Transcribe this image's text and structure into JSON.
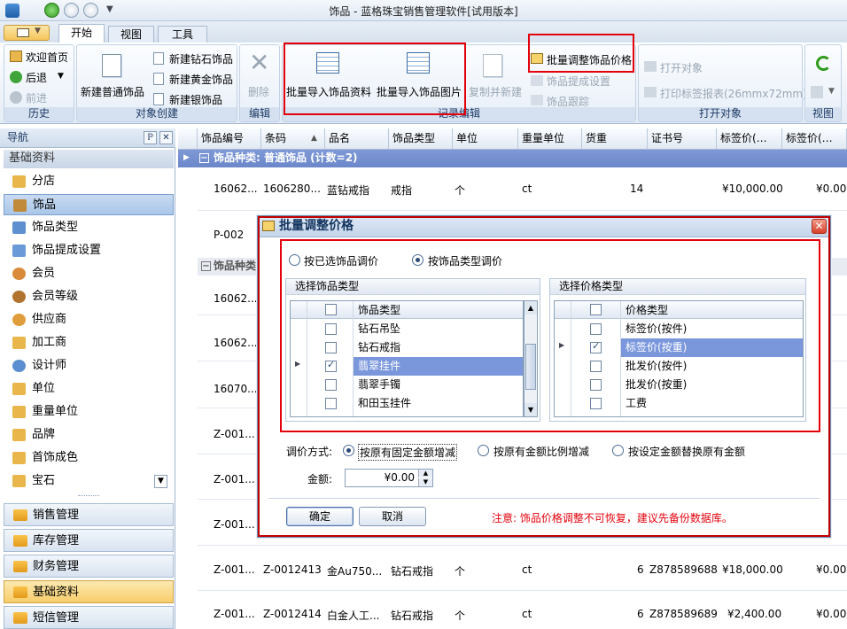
{
  "window": {
    "title": "饰品 - 蓝格珠宝销售管理软件[试用版本]"
  },
  "tabs": [
    "开始",
    "视图",
    "工具"
  ],
  "ribbon": {
    "history": {
      "label": "历史",
      "welcome": "欢迎首页",
      "back": "后退",
      "forward": "前进"
    },
    "create": {
      "label": "对象创建",
      "new_normal": "新建普通饰品",
      "new_diamond": "新建钻石饰品",
      "new_gold": "新建黄金饰品",
      "new_silver": "新建银饰品"
    },
    "edit": {
      "label": "编辑",
      "delete": "删除"
    },
    "records": {
      "label": "记录编辑",
      "import_data": "批量导入饰品资料",
      "import_image": "批量导入饰品图片",
      "copy_new": "复制并新建",
      "batch_price": "批量调整饰品价格",
      "commission": "饰品提成设置",
      "track": "饰品跟踪"
    },
    "open": {
      "label": "打开对象",
      "open_obj": "打开对象",
      "print": "打印标签报表(26mmx72mm)"
    },
    "view": {
      "label": "视图"
    }
  },
  "nav": {
    "title": "导航",
    "group": "基础资料",
    "items": [
      "分店",
      "饰品",
      "饰品类型",
      "饰品提成设置",
      "会员",
      "会员等级",
      "供应商",
      "加工商",
      "设计师",
      "单位",
      "重量单位",
      "品牌",
      "首饰成色",
      "宝石"
    ],
    "selected": "饰品",
    "categories": [
      "销售管理",
      "库存管理",
      "财务管理",
      "基础资料",
      "短信管理"
    ],
    "selected_category": "基础资料"
  },
  "grid": {
    "columns": [
      "饰品编号",
      "条码",
      "品名",
      "饰品类型",
      "单位",
      "重量单位",
      "货重",
      "证书号",
      "标签价(…",
      "标签价(…"
    ],
    "group1": "饰品种类: 普通饰品 (计数=2)",
    "group2": "饰品种类",
    "rows": [
      {
        "id": "16062...",
        "barcode": "1606280...",
        "name": "蓝钻戒指",
        "type": "戒指",
        "unit": "个",
        "wunit": "ct",
        "weight": "14",
        "cert": "",
        "price1": "¥10,000.00",
        "price2": "¥0.00"
      },
      {
        "id": "P-002"
      },
      {
        "id": "16062..."
      },
      {
        "id": "16062..."
      },
      {
        "id": "16070..."
      },
      {
        "id": "Z-001..."
      },
      {
        "id": "Z-001..."
      },
      {
        "id": "Z-001..."
      },
      {
        "id": "Z-001...",
        "barcode": "Z-0012413",
        "name": "金Au750...",
        "type": "钻石戒指",
        "unit": "个",
        "wunit": "ct",
        "weight": "6",
        "cert": "Z878589688",
        "price1": "¥18,000.00",
        "price2": "¥0.00"
      },
      {
        "id": "Z-001...",
        "barcode": "Z-0012414",
        "name": "白金人工...",
        "type": "钻石戒指",
        "unit": "个",
        "wunit": "ct",
        "weight": "6",
        "cert": "Z878589689",
        "price1": "¥2,400.00",
        "price2": "¥0.00"
      }
    ]
  },
  "dialog": {
    "title": "批量调整价格",
    "mode_selected": "按已选饰品调价",
    "mode_type": "按饰品类型调价",
    "type_box_title": "选择饰品类型",
    "type_col": "饰品类型",
    "types": [
      {
        "name": "钻石吊坠",
        "checked": false
      },
      {
        "name": "钻石戒指",
        "checked": false
      },
      {
        "name": "翡翠挂件",
        "checked": true
      },
      {
        "name": "翡翠手镯",
        "checked": false
      },
      {
        "name": "和田玉挂件",
        "checked": false
      }
    ],
    "price_box_title": "选择价格类型",
    "price_col": "价格类型",
    "prices": [
      {
        "name": "标签价(按件)",
        "checked": false
      },
      {
        "name": "标签价(按重)",
        "checked": true
      },
      {
        "name": "批发价(按件)",
        "checked": false
      },
      {
        "name": "批发价(按重)",
        "checked": false
      },
      {
        "name": "工费",
        "checked": false
      }
    ],
    "adjust_label": "调价方式:",
    "adjust_fixed": "按原有固定金额增减",
    "adjust_ratio": "按原有金额比例增减",
    "adjust_replace": "按设定金额替换原有金额",
    "amount_label": "金额:",
    "amount_value": "¥0.00",
    "ok": "确定",
    "cancel": "取消",
    "note": "注意: 饰品价格调整不可恢复，建议先备份数据库。"
  }
}
